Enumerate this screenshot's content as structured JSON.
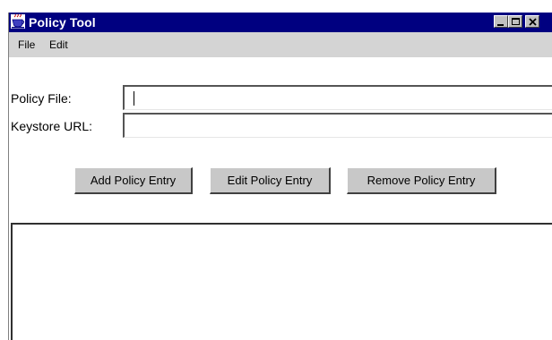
{
  "window": {
    "title": "Policy Tool",
    "icon": "java-app-icon",
    "controls": [
      "minimize-icon",
      "maximize-icon",
      "close-icon"
    ]
  },
  "menubar": {
    "items": [
      {
        "label": "File"
      },
      {
        "label": "Edit"
      }
    ]
  },
  "form": {
    "policy_file": {
      "label": "Policy File:",
      "value": ""
    },
    "keystore_url": {
      "label": "Keystore URL:",
      "value": ""
    }
  },
  "buttons": {
    "add": "Add Policy Entry",
    "edit": "Edit Policy Entry",
    "remove": "Remove Policy Entry"
  },
  "policy_list": {
    "entries": []
  },
  "colors": {
    "titlebar": "#000080",
    "menubar": "#d4d4d4",
    "button_face": "#c8c8c8",
    "background": "#ffffff"
  }
}
